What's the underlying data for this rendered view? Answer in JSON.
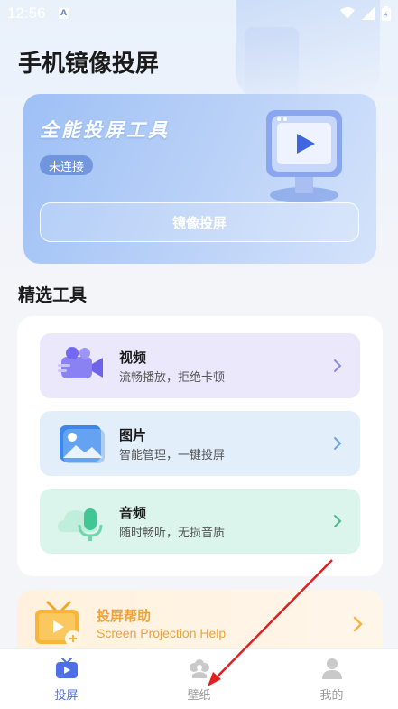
{
  "status_bar": {
    "time": "12:56",
    "notif_badge": "A"
  },
  "page_title": "手机镜像投屏",
  "hero": {
    "title": "全能投屏工具",
    "status": "未连接",
    "button_label": "镜像投屏"
  },
  "section": {
    "title": "精选工具"
  },
  "tools": [
    {
      "name": "视频",
      "desc": "流畅播放，拒绝卡顿",
      "bg": "#ebe8fb",
      "icon": "video-camera-icon"
    },
    {
      "name": "图片",
      "desc": "智能管理，一键投屏",
      "bg": "#e3eefb",
      "icon": "image-icon"
    },
    {
      "name": "音频",
      "desc": "随时畅听，无损音质",
      "bg": "#dcf5ec",
      "icon": "microphone-icon"
    }
  ],
  "help": {
    "title": "投屏帮助",
    "subtitle": "Screen Projection Help"
  },
  "tabbar": {
    "items": [
      {
        "label": "投屏",
        "icon": "tv-icon",
        "active": true
      },
      {
        "label": "壁纸",
        "icon": "flower-icon",
        "active": false
      },
      {
        "label": "我的",
        "icon": "user-icon",
        "active": false
      }
    ]
  },
  "colors": {
    "accent": "#4f6fe8",
    "help_orange": "#f0a23a"
  }
}
